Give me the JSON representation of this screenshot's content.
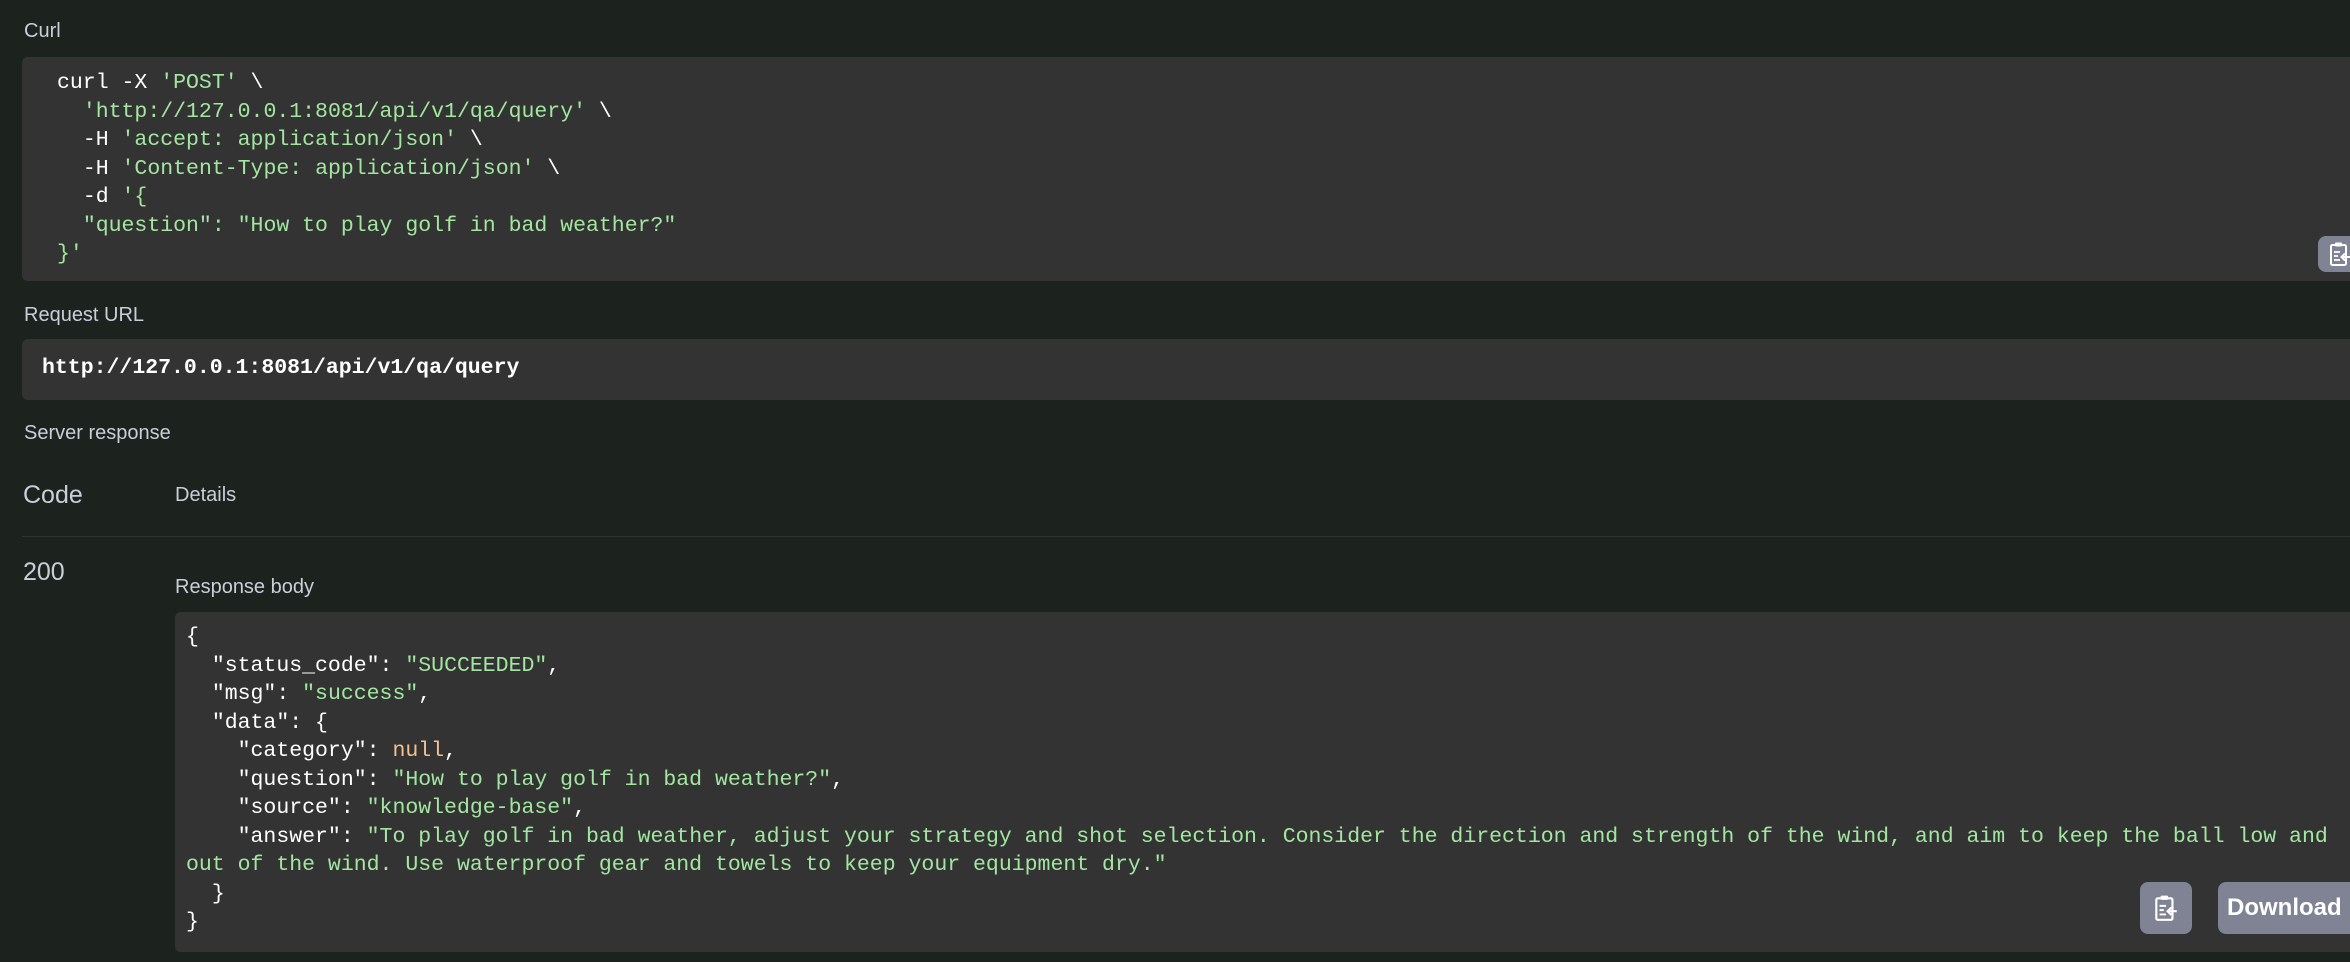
{
  "curl": {
    "label": "Curl",
    "lines": {
      "l1_cmd": "curl -X ",
      "l1_method": "'POST'",
      "l1_end": " \\",
      "l2_indent": "  ",
      "l2_url": "'http://127.0.0.1:8081/api/v1/qa/query'",
      "l2_end": " \\",
      "l3_flag": "  -H ",
      "l3_val": "'accept: application/json'",
      "l3_end": " \\",
      "l4_flag": "  -H ",
      "l4_val": "'Content-Type: application/json'",
      "l4_end": " \\",
      "l5_flag": "  -d ",
      "l5_val": "'{",
      "l6_val": "  \"question\": \"How to play golf in bad weather?\"",
      "l7_val": "}'"
    },
    "copy_icon": "clipboard-copy-icon"
  },
  "request_url": {
    "label": "Request URL",
    "value": "http://127.0.0.1:8081/api/v1/qa/query"
  },
  "server_response": {
    "label": "Server response",
    "code_header": "Code",
    "details_header": "Details",
    "code": "200",
    "response_body_label": "Response body",
    "body": {
      "open": "{",
      "status_code_key": "  \"status_code\": ",
      "status_code_val": "\"SUCCEEDED\"",
      "msg_key": "  \"msg\": ",
      "msg_val": "\"success\"",
      "data_key": "  \"data\": {",
      "category_key": "    \"category\": ",
      "category_val": "null",
      "question_key": "    \"question\": ",
      "question_val": "\"How to play golf in bad weather?\"",
      "source_key": "    \"source\": ",
      "source_val": "\"knowledge-base\"",
      "answer_key": "    \"answer\": ",
      "answer_val": "\"To play golf in bad weather, adjust your strategy and shot selection. Consider the direction and strength of the wind, and aim to keep the ball low and out of the wind. Use waterproof gear and towels to keep your equipment dry.\"",
      "data_close": "  }",
      "close": "}",
      "comma": ","
    },
    "copy_icon": "clipboard-copy-icon",
    "download_label": "Download"
  },
  "colors": {
    "background": "#1c231f",
    "code_block": "#333333",
    "string": "#a2e7a0",
    "null": "#f6c08e",
    "button": "#7f8393"
  }
}
